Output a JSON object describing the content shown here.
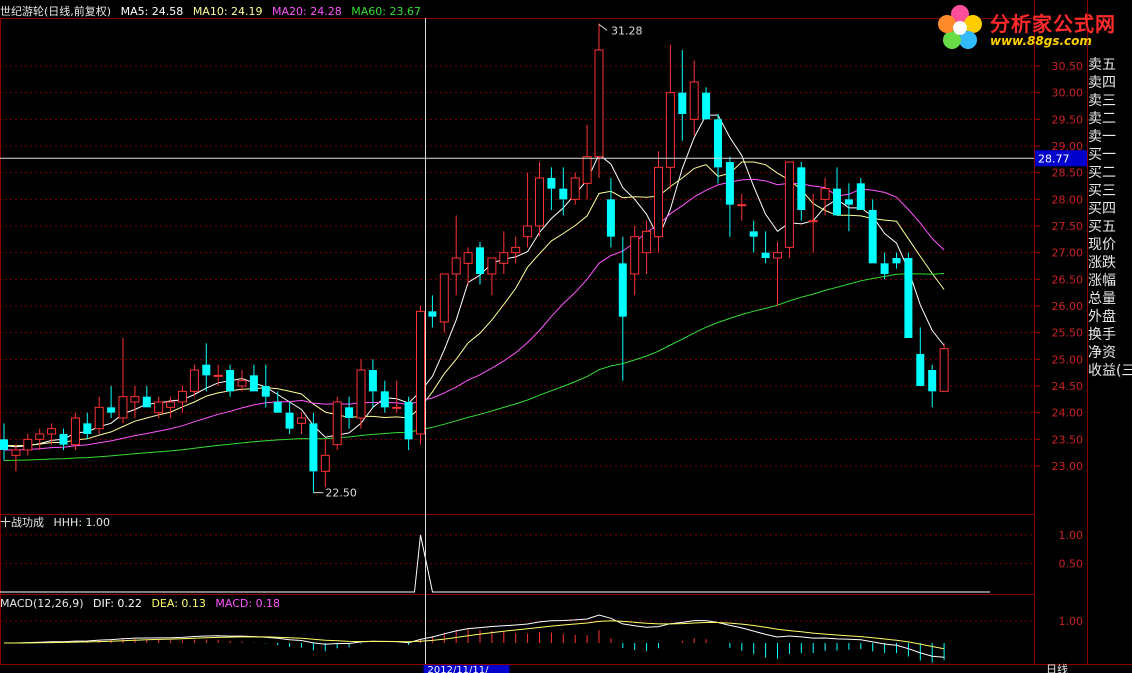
{
  "header": {
    "title": "世纪游轮(日线,前复权)",
    "ma5": "MA5: 24.58",
    "ma10": "MA10: 24.19",
    "ma20": "MA20: 24.28",
    "ma60": "MA60: 23.67",
    "ma5_color": "#ffffff",
    "ma10_color": "#ffff99",
    "ma20_color": "#ff55ff",
    "ma60_color": "#33dd33"
  },
  "indicator": {
    "title": "十战功成",
    "value": "HHH: 1.00"
  },
  "macd": {
    "title": "MACD(12,26,9)",
    "dif": "DIF: 0.22",
    "dea": "DEA: 0.13",
    "macd": "MACD: 0.18"
  },
  "side_panel": {
    "items": [
      "卖五",
      "卖四",
      "卖三",
      "卖二",
      "卖一",
      "买一",
      "买二",
      "买三",
      "买四",
      "买五",
      "现价",
      "涨跌",
      "涨幅",
      "总量",
      "外盘",
      "换手",
      "净资",
      "收益(三"
    ]
  },
  "logo": {
    "brand": "分析家公式网",
    "url": "www.88gs.com"
  },
  "bottom_bar": {
    "date_label": "2012/11/11/",
    "period_label": "日线"
  },
  "chart_data": {
    "type": "candlestick",
    "price_ticks": [
      "30.50",
      "30.00",
      "29.50",
      "29.00",
      "28.50",
      "28.00",
      "27.50",
      "27.00",
      "26.50",
      "26.00",
      "25.50",
      "25.00",
      "24.50",
      "24.00",
      "23.50",
      "23.00"
    ],
    "price_range": [
      22.9,
      30.62
    ],
    "crosshair_price": "28.77",
    "high_label": "31.28",
    "low_label": "22.50",
    "indicator_ticks": [
      "1.00",
      "0.50"
    ],
    "macd_ticks": [
      "1.00"
    ],
    "candles": [
      [
        23.5,
        23.8,
        23.1,
        23.3
      ],
      [
        23.2,
        23.4,
        22.9,
        23.3
      ],
      [
        23.3,
        23.6,
        23.2,
        23.5
      ],
      [
        23.5,
        23.7,
        23.3,
        23.6
      ],
      [
        23.6,
        23.8,
        23.4,
        23.7
      ],
      [
        23.6,
        23.7,
        23.3,
        23.4
      ],
      [
        23.4,
        24.0,
        23.3,
        23.9
      ],
      [
        23.8,
        24.0,
        23.5,
        23.6
      ],
      [
        23.7,
        24.3,
        23.6,
        24.1
      ],
      [
        24.1,
        24.5,
        23.9,
        24.0
      ],
      [
        23.9,
        25.4,
        23.8,
        24.3
      ],
      [
        24.2,
        24.5,
        23.9,
        24.3
      ],
      [
        24.3,
        24.5,
        24.1,
        24.1
      ],
      [
        24.0,
        24.3,
        23.9,
        24.2
      ],
      [
        24.1,
        24.3,
        23.9,
        24.2
      ],
      [
        24.2,
        24.5,
        24.0,
        24.4
      ],
      [
        24.4,
        24.9,
        24.3,
        24.8
      ],
      [
        24.9,
        25.3,
        24.4,
        24.7
      ],
      [
        24.7,
        24.9,
        24.5,
        24.7
      ],
      [
        24.8,
        24.9,
        24.3,
        24.4
      ],
      [
        24.5,
        24.8,
        24.4,
        24.6
      ],
      [
        24.7,
        24.9,
        24.4,
        24.4
      ],
      [
        24.5,
        24.9,
        24.1,
        24.3
      ],
      [
        24.2,
        24.4,
        24.0,
        24.0
      ],
      [
        24.0,
        24.2,
        23.6,
        23.7
      ],
      [
        23.8,
        24.0,
        23.6,
        23.9
      ],
      [
        23.8,
        24.0,
        22.5,
        22.9
      ],
      [
        22.9,
        23.5,
        22.6,
        23.2
      ],
      [
        23.4,
        24.3,
        23.3,
        24.2
      ],
      [
        24.1,
        24.3,
        23.7,
        23.9
      ],
      [
        23.9,
        25.0,
        23.7,
        24.8
      ],
      [
        24.8,
        25.0,
        24.1,
        24.4
      ],
      [
        24.4,
        24.6,
        24.0,
        24.1
      ],
      [
        24.1,
        24.6,
        24.0,
        24.1
      ],
      [
        24.2,
        24.3,
        23.3,
        23.5
      ],
      [
        23.6,
        26.0,
        23.4,
        25.9
      ],
      [
        25.9,
        26.2,
        25.6,
        25.8
      ],
      [
        25.7,
        26.6,
        25.5,
        26.6
      ],
      [
        26.6,
        27.7,
        26.2,
        26.9
      ],
      [
        26.8,
        27.1,
        26.4,
        27.0
      ],
      [
        27.1,
        27.2,
        26.4,
        26.6
      ],
      [
        26.6,
        26.9,
        26.2,
        26.9
      ],
      [
        26.8,
        27.4,
        26.6,
        27.0
      ],
      [
        27.0,
        27.3,
        26.8,
        27.1
      ],
      [
        27.3,
        28.5,
        27.1,
        27.5
      ],
      [
        27.5,
        28.7,
        27.3,
        28.4
      ],
      [
        28.4,
        28.6,
        27.8,
        28.2
      ],
      [
        28.2,
        28.6,
        27.7,
        28.0
      ],
      [
        28.0,
        28.5,
        27.9,
        28.4
      ],
      [
        28.3,
        29.4,
        28.0,
        28.8
      ],
      [
        28.8,
        31.3,
        28.4,
        30.8
      ],
      [
        28.0,
        28.4,
        27.1,
        27.3
      ],
      [
        26.8,
        27.3,
        24.6,
        25.8
      ],
      [
        26.6,
        27.5,
        26.2,
        27.3
      ],
      [
        27.0,
        27.6,
        26.6,
        27.4
      ],
      [
        27.3,
        28.9,
        27.0,
        28.6
      ],
      [
        28.6,
        30.9,
        28.2,
        30.0
      ],
      [
        30.0,
        30.8,
        29.1,
        29.6
      ],
      [
        29.5,
        30.6,
        29.2,
        30.2
      ],
      [
        30.0,
        30.1,
        29.5,
        29.5
      ],
      [
        29.5,
        29.6,
        28.3,
        28.6
      ],
      [
        28.7,
        28.8,
        27.3,
        27.9
      ],
      [
        27.9,
        28.1,
        27.6,
        27.9
      ],
      [
        27.4,
        27.6,
        27.0,
        27.3
      ],
      [
        27.0,
        27.4,
        26.8,
        26.9
      ],
      [
        26.9,
        27.2,
        26.0,
        27.0
      ],
      [
        27.1,
        28.7,
        26.9,
        28.7
      ],
      [
        28.6,
        28.7,
        27.6,
        27.8
      ],
      [
        27.6,
        28.1,
        27.0,
        27.6
      ],
      [
        28.0,
        28.4,
        27.7,
        28.2
      ],
      [
        28.2,
        28.6,
        27.7,
        27.7
      ],
      [
        28.0,
        28.3,
        27.4,
        27.9
      ],
      [
        28.3,
        28.4,
        27.9,
        27.8
      ],
      [
        27.8,
        28.0,
        26.9,
        26.8
      ],
      [
        26.8,
        27.0,
        26.5,
        26.6
      ],
      [
        26.9,
        27.0,
        26.7,
        26.8
      ],
      [
        26.9,
        27.0,
        25.6,
        25.4
      ],
      [
        25.1,
        25.6,
        24.5,
        24.5
      ],
      [
        24.8,
        24.9,
        24.1,
        24.4
      ],
      [
        24.4,
        25.3,
        24.4,
        25.2
      ]
    ],
    "indicator_spike_at": 35,
    "crosshair_index": 35
  }
}
